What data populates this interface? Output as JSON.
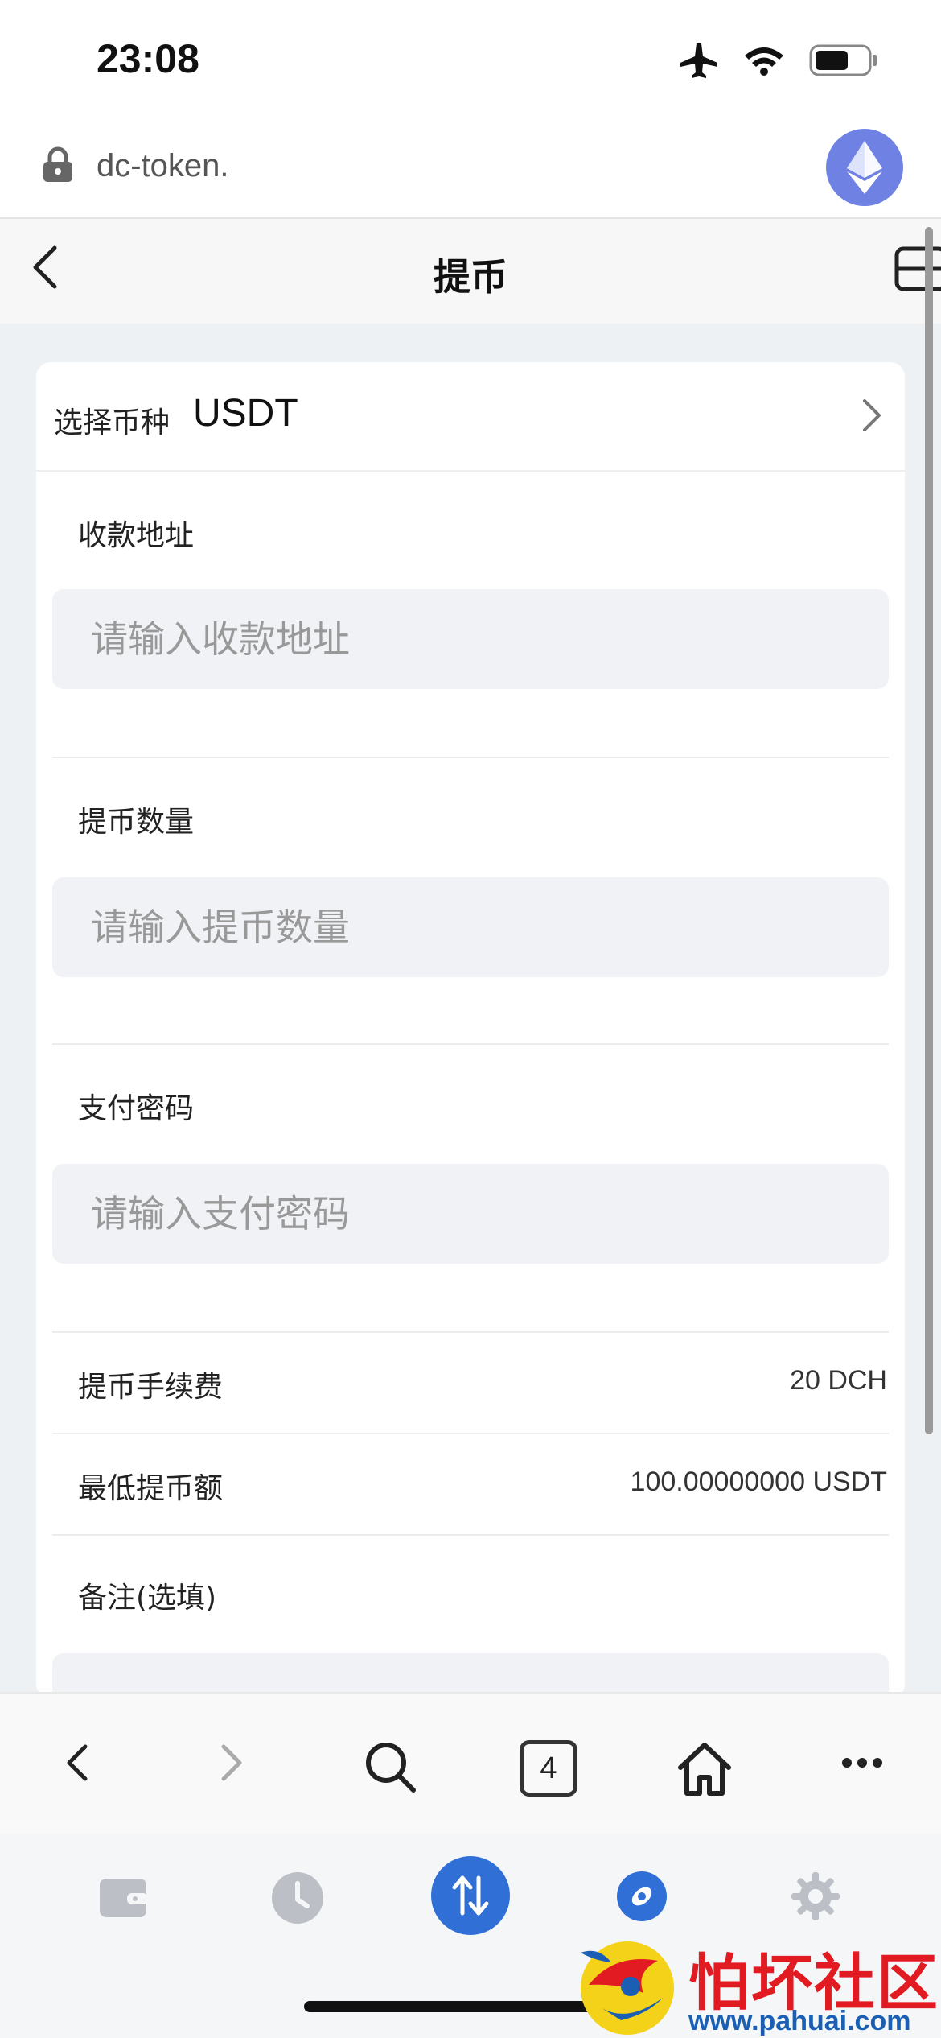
{
  "status_bar": {
    "time": "23:08"
  },
  "url_bar": {
    "url": "dc-token."
  },
  "header": {
    "title": "提币"
  },
  "form": {
    "coin_label": "选择币种",
    "coin_value": "USDT",
    "address": {
      "label": "收款地址",
      "placeholder": "请输入收款地址",
      "value": ""
    },
    "amount": {
      "label": "提币数量",
      "placeholder": "请输入提币数量",
      "value": ""
    },
    "password": {
      "label": "支付密码",
      "placeholder": "请输入支付密码",
      "value": ""
    },
    "fee": {
      "label": "提币手续费",
      "value": "20 DCH"
    },
    "minimum": {
      "label": "最低提币额",
      "value": "100.00000000 USDT"
    },
    "remark": {
      "label": "备注(选填)"
    }
  },
  "browser_toolbar": {
    "tab_count": "4"
  },
  "tab_bar": {
    "items": [
      "wallet-icon",
      "history-icon",
      "transfer-icon",
      "discover-icon",
      "settings-icon"
    ],
    "active": "transfer-icon"
  },
  "watermark": {
    "text": "怕坏社区",
    "url": "www.pahuai.com"
  },
  "colors": {
    "accent": "#2f6fd6",
    "eth": "#6f82e3",
    "input_bg": "#f0f2f5",
    "watermark_red": "#e21b22"
  }
}
